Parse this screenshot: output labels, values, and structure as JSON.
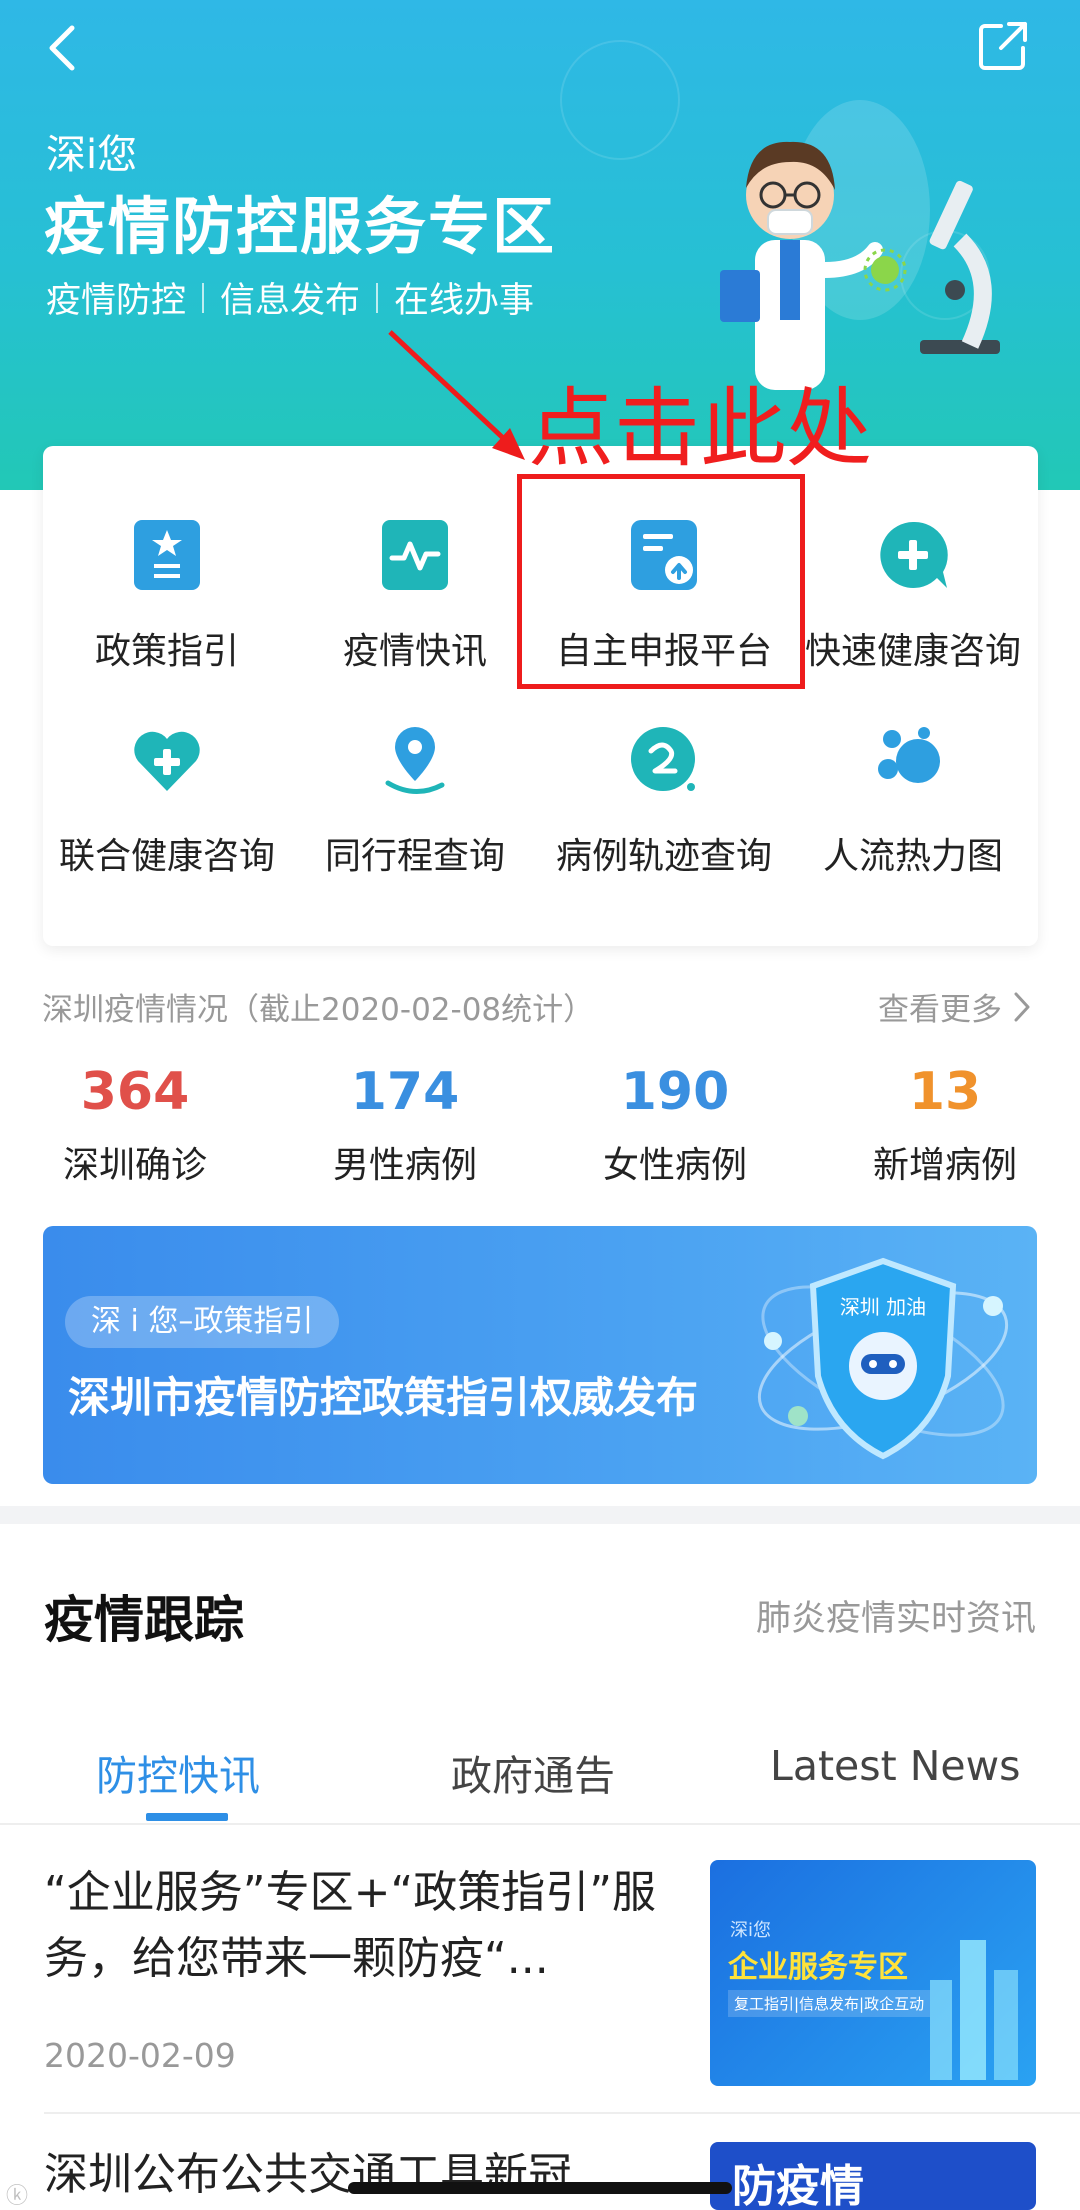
{
  "header": {
    "brand_sub": "深i您",
    "brand_title": "疫情防控服务专区",
    "tags": [
      "疫情防控",
      "信息发布",
      "在线办事"
    ]
  },
  "annotation": {
    "text": "点击此处",
    "color": "#f01e1e"
  },
  "services": [
    {
      "label": "政策指引",
      "icon": "policy-guide-icon"
    },
    {
      "label": "疫情快讯",
      "icon": "epidemic-news-icon"
    },
    {
      "label": "自主申报平台",
      "icon": "self-report-icon"
    },
    {
      "label": "快速健康咨询",
      "icon": "health-consult-icon"
    },
    {
      "label": "联合健康咨询",
      "icon": "joint-health-icon"
    },
    {
      "label": "同行程查询",
      "icon": "itinerary-icon"
    },
    {
      "label": "病例轨迹查询",
      "icon": "case-track-icon"
    },
    {
      "label": "人流热力图",
      "icon": "heatmap-icon"
    }
  ],
  "stats": {
    "title": "深圳疫情情况（截止2020-02-08统计）",
    "more": "查看更多",
    "items": [
      {
        "value": "364",
        "caption": "深圳确诊",
        "color": "#e0504a"
      },
      {
        "value": "174",
        "caption": "男性病例",
        "color": "#3a8fe0"
      },
      {
        "value": "190",
        "caption": "女性病例",
        "color": "#3a8fe0"
      },
      {
        "value": "13",
        "caption": "新增病例",
        "color": "#f0922c"
      }
    ]
  },
  "policy_banner": {
    "pill": "深 i 您–政策指引",
    "title": "深圳市疫情防控政策指引权威发布",
    "shield_text": "深圳 加油"
  },
  "tracking": {
    "title": "疫情跟踪",
    "subtitle": "肺炎疫情实时资讯",
    "tabs": [
      "防控快讯",
      "政府通告",
      "Latest News"
    ],
    "active_tab": 0
  },
  "news": [
    {
      "headline": "“企业服务”专区+“政策指引”服务，给您带来一颗防疫“...",
      "date": "2020-02-09",
      "thumb": {
        "small": "深i您",
        "title": "企业服务专区",
        "sub": "复工指引|信息发布|政企互动"
      }
    },
    {
      "headline": "深圳公布公共交通工具新冠",
      "date": "",
      "thumb": {
        "title": "防疫情"
      }
    }
  ],
  "colors": {
    "accent": "#2e8fe6",
    "header_top": "#2fb8e6",
    "header_bottom": "#22c8b6",
    "icon_teal": "#1fb5b8",
    "icon_blue": "#2e9fe0"
  }
}
